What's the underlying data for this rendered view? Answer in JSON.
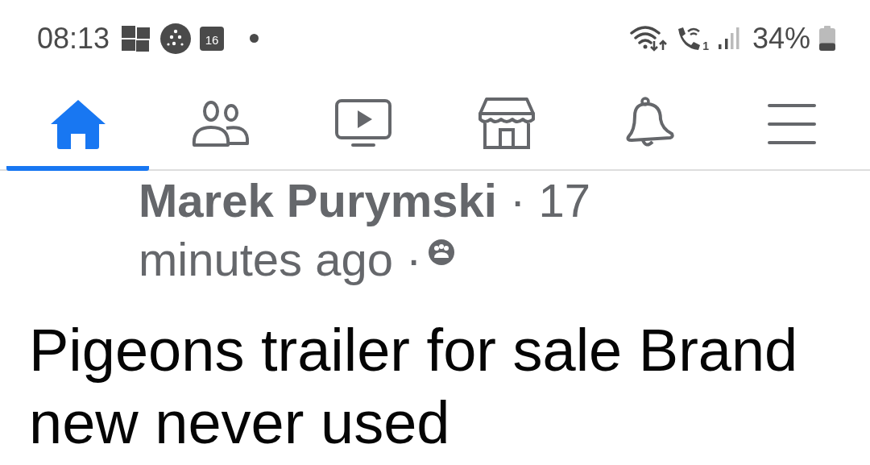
{
  "status_bar": {
    "time": "08:13",
    "calendar_day": "16",
    "sim_number": "1",
    "battery": "34%",
    "battery_meter": {
      "level": 0.34
    }
  },
  "tabs": [
    {
      "kind": "home",
      "selected": true
    },
    {
      "kind": "friends",
      "selected": false
    },
    {
      "kind": "video",
      "selected": false
    },
    {
      "kind": "marketplace",
      "selected": false
    },
    {
      "kind": "notifications",
      "selected": false
    },
    {
      "kind": "menu",
      "selected": false
    }
  ],
  "post": {
    "meta_lines": [
      "**Marek Purymski** · 17",
      "minutes ago ·"
    ],
    "title": "Pigeons trailer for sale Brand new never used"
  }
}
